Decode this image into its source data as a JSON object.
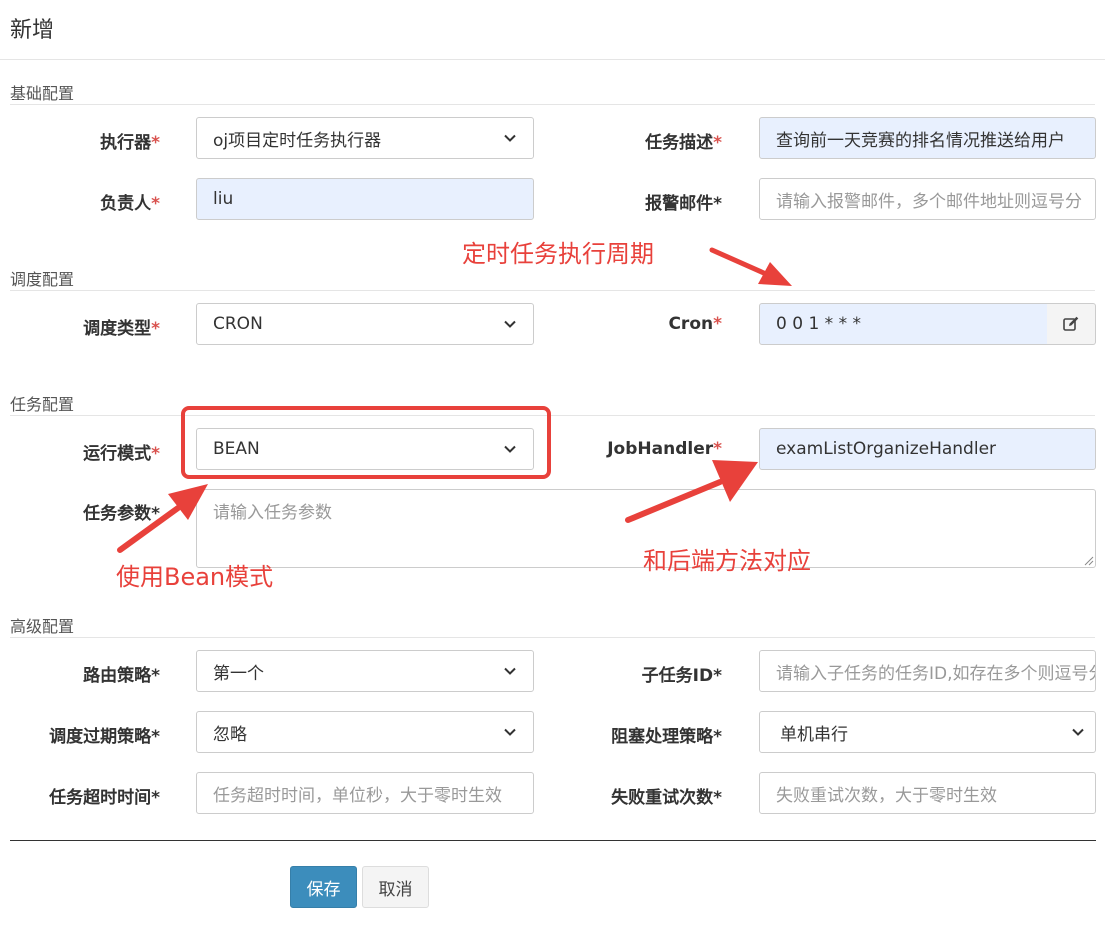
{
  "dialog": {
    "title": "新增"
  },
  "sections": {
    "basic": "基础配置",
    "schedule": "调度配置",
    "task": "任务配置",
    "advanced": "高级配置"
  },
  "fields": {
    "executor": {
      "label": "执行器",
      "required_mark": "*",
      "value": "oj项目定时任务执行器"
    },
    "job_desc": {
      "label": "任务描述",
      "required_mark": "*",
      "value": "查询前一天竞赛的排名情况推送给用户"
    },
    "author": {
      "label": "负责人",
      "required_mark": "*",
      "value": "liu"
    },
    "alarm_email": {
      "label": "报警邮件",
      "required_mark": "*",
      "placeholder": "请输入报警邮件，多个邮件地址则逗号分"
    },
    "schedule_type": {
      "label": "调度类型",
      "required_mark": "*",
      "value": "CRON"
    },
    "cron": {
      "label": "Cron",
      "required_mark": "*",
      "value": "0 0 1 * * *"
    },
    "glue_type": {
      "label": "运行模式",
      "required_mark": "*",
      "value": "BEAN"
    },
    "job_handler": {
      "label": "JobHandler",
      "required_mark": "*",
      "value": "examListOrganizeHandler"
    },
    "job_param": {
      "label": "任务参数",
      "required_mark": "*",
      "placeholder": "请输入任务参数"
    },
    "route_strategy": {
      "label": "路由策略",
      "required_mark": "*",
      "value": "第一个"
    },
    "child_job_id": {
      "label": "子任务ID",
      "required_mark": "*",
      "placeholder": "请输入子任务的任务ID,如存在多个则逗号分隔"
    },
    "misfire_strategy": {
      "label": "调度过期策略",
      "required_mark": "*",
      "value": "忽略"
    },
    "block_strategy": {
      "label": "阻塞处理策略",
      "required_mark": "*",
      "value": "单机串行"
    },
    "timeout": {
      "label": "任务超时时间",
      "required_mark": "*",
      "placeholder": "任务超时时间，单位秒，大于零时生效"
    },
    "fail_retry": {
      "label": "失败重试次数",
      "required_mark": "*",
      "placeholder": "失败重试次数，大于零时生效"
    }
  },
  "annotations": {
    "cron_period": "定时任务执行周期",
    "bean_mode": "使用Bean模式",
    "backend_method": "和后端方法对应"
  },
  "buttons": {
    "save": "保存",
    "cancel": "取消"
  },
  "icons": {
    "select_chevron": "chevron-down-icon",
    "cron_edit": "edit-icon"
  },
  "colors": {
    "annotation": "#e8413b",
    "primary": "#3c8dbc",
    "required": "#d9534f",
    "autofill": "#e8f0fe"
  }
}
